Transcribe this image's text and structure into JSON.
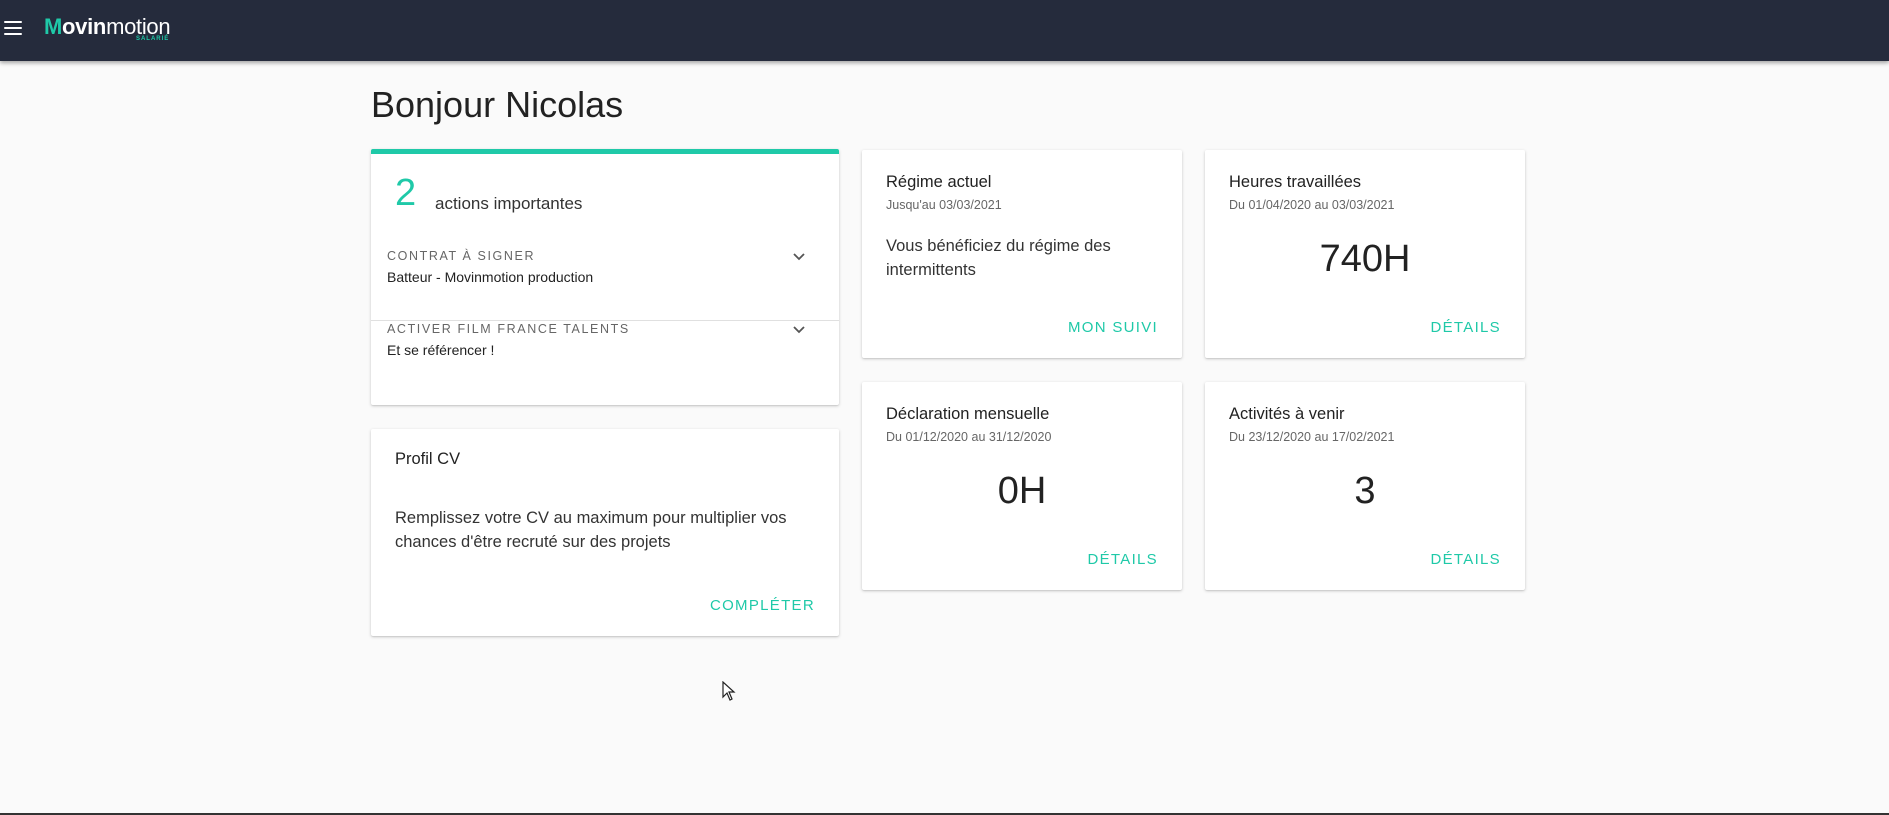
{
  "app": {
    "logo_bold": "ovin",
    "logo_light": "motion",
    "logo_m": "M",
    "logo_sub": "SALARIÉ"
  },
  "greeting": "Bonjour Nicolas",
  "actions": {
    "count": "2",
    "label": "actions importantes",
    "items": [
      {
        "kicker": "CONTRAT À SIGNER",
        "sub": "Batteur - Movinmotion production"
      },
      {
        "kicker": "ACTIVER FILM FRANCE TALENTS",
        "sub": "Et se référencer !"
      }
    ]
  },
  "cv": {
    "title": "Profil CV",
    "body": "Remplissez votre CV au maximum pour multiplier vos chances d'être recruté sur des projets",
    "link": "COMPLÉTER"
  },
  "regime": {
    "title": "Régime actuel",
    "sub": "Jusqu'au 03/03/2021",
    "body": "Vous bénéficiez du régime des intermittents",
    "link": "MON SUIVI"
  },
  "hours": {
    "title": "Heures travaillées",
    "sub": "Du 01/04/2020 au 03/03/2021",
    "value": "740H",
    "link": "DÉTAILS"
  },
  "declaration": {
    "title": "Déclaration mensuelle",
    "sub": "Du 01/12/2020 au 31/12/2020",
    "value": "0H",
    "link": "DÉTAILS"
  },
  "upcoming": {
    "title": "Activités à venir",
    "sub": "Du 23/12/2020 au 17/02/2021",
    "value": "3",
    "link": "DÉTAILS"
  },
  "colors": {
    "topbar": "#252b3c",
    "accent": "#1fc9a8",
    "background": "#fafafa"
  }
}
